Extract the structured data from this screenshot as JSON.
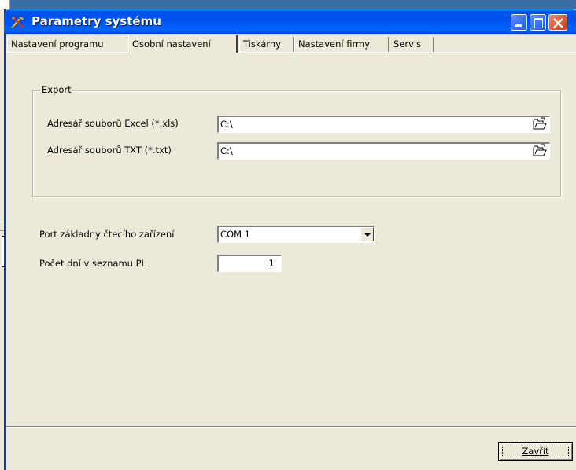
{
  "window": {
    "title": "Parametry systému"
  },
  "tabs": [
    {
      "label": "Nastavení programu",
      "active": false
    },
    {
      "label": "Osobní nastavení",
      "active": true
    },
    {
      "label": "Tiskárny",
      "active": false
    },
    {
      "label": "Nastavení firmy",
      "active": false
    },
    {
      "label": "Servis",
      "active": false
    }
  ],
  "export": {
    "group_label": "Export",
    "excel_label": "Adresář souborů Excel (*.xls)",
    "excel_value": "C:\\",
    "txt_label": "Adresář souborů TXT (*.txt)",
    "txt_value": "C:\\"
  },
  "port": {
    "label": "Port základny čtecího zařízení",
    "value": "COM 1"
  },
  "days": {
    "label": "Počet dní v seznamu PL",
    "value": "1"
  },
  "buttons": {
    "close_label": "Zavřít"
  },
  "colors": {
    "titlebar": "#0054e3",
    "face": "#ece9d8",
    "close": "#d03a14"
  },
  "icons": [
    "app-icon",
    "minimize-icon",
    "maximize-icon",
    "close-icon",
    "folder-open-icon",
    "chevron-down-icon"
  ]
}
